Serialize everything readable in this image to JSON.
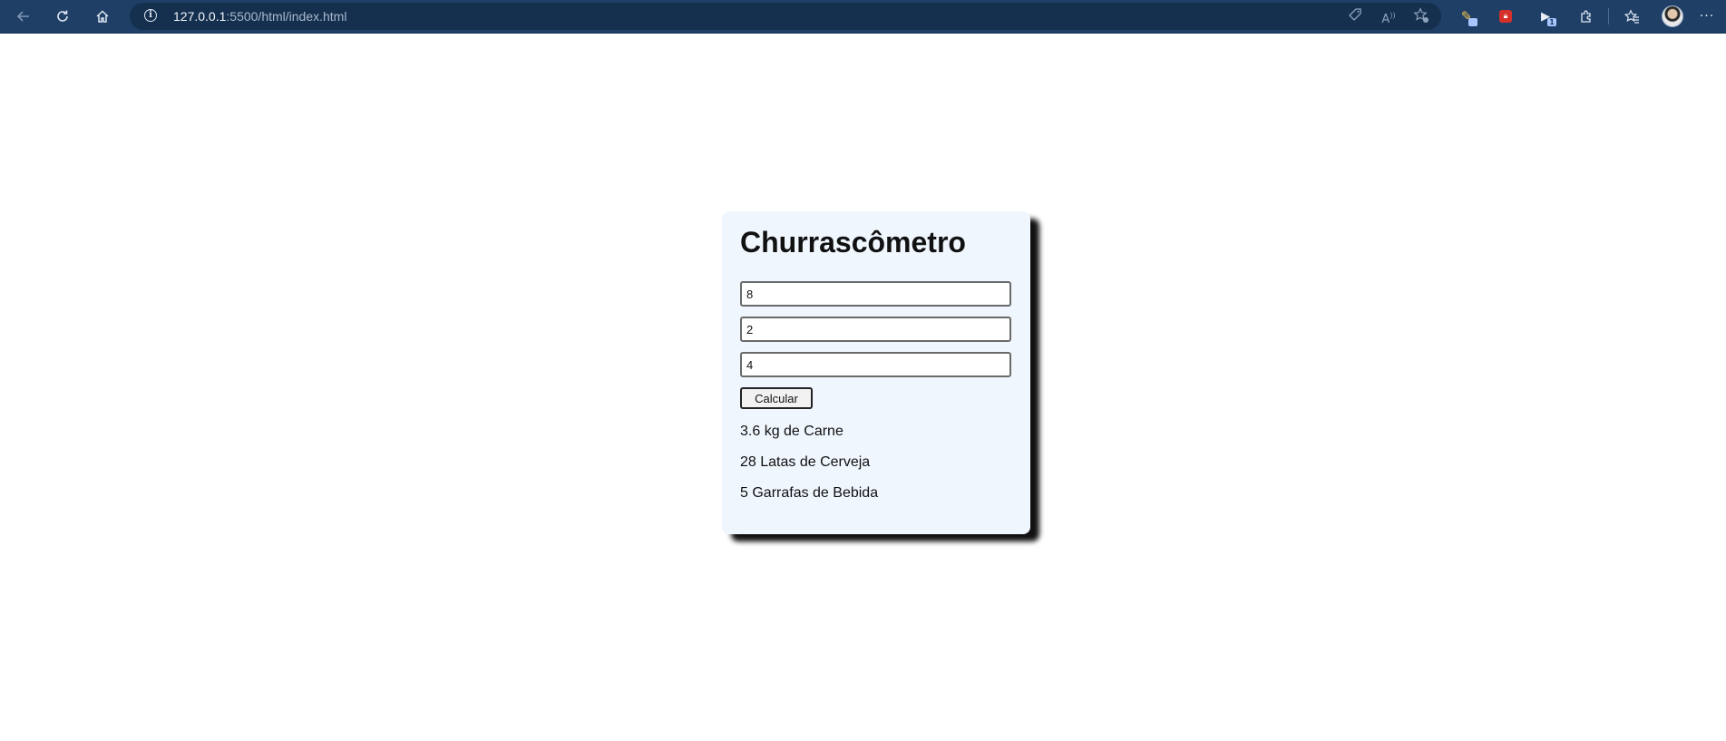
{
  "browser": {
    "url_host": "127.0.0.1",
    "url_rest": ":5500/html/index.html",
    "icons": {
      "back": "arrow-left-icon",
      "reload": "reload-icon",
      "home": "home-icon",
      "info": "info-icon",
      "tag": "tag-icon",
      "read_aloud": "read-aloud-icon",
      "favorite_add": "favorite-add-icon",
      "extension_1": "pencil-extension-icon",
      "extension_2": "lock-extension-icon",
      "extension_3": "video-extension-icon",
      "extensions": "puzzle-icon",
      "favorites": "favorites-icon",
      "more": "more-icon"
    },
    "extension_badge": "1",
    "colors": {
      "toolbar": "#1f3f66",
      "address_bar": "#15304f"
    }
  },
  "app": {
    "title": "Churrascômetro",
    "inputs": [
      {
        "value": "8"
      },
      {
        "value": "2"
      },
      {
        "value": "4"
      }
    ],
    "button_label": "Calcular",
    "results": [
      "3.6 kg de Carne",
      "28 Latas de Cerveja",
      "5 Garrafas de Bebida"
    ],
    "colors": {
      "card_background": "#f0f6fe",
      "shadow": "#111111"
    }
  }
}
